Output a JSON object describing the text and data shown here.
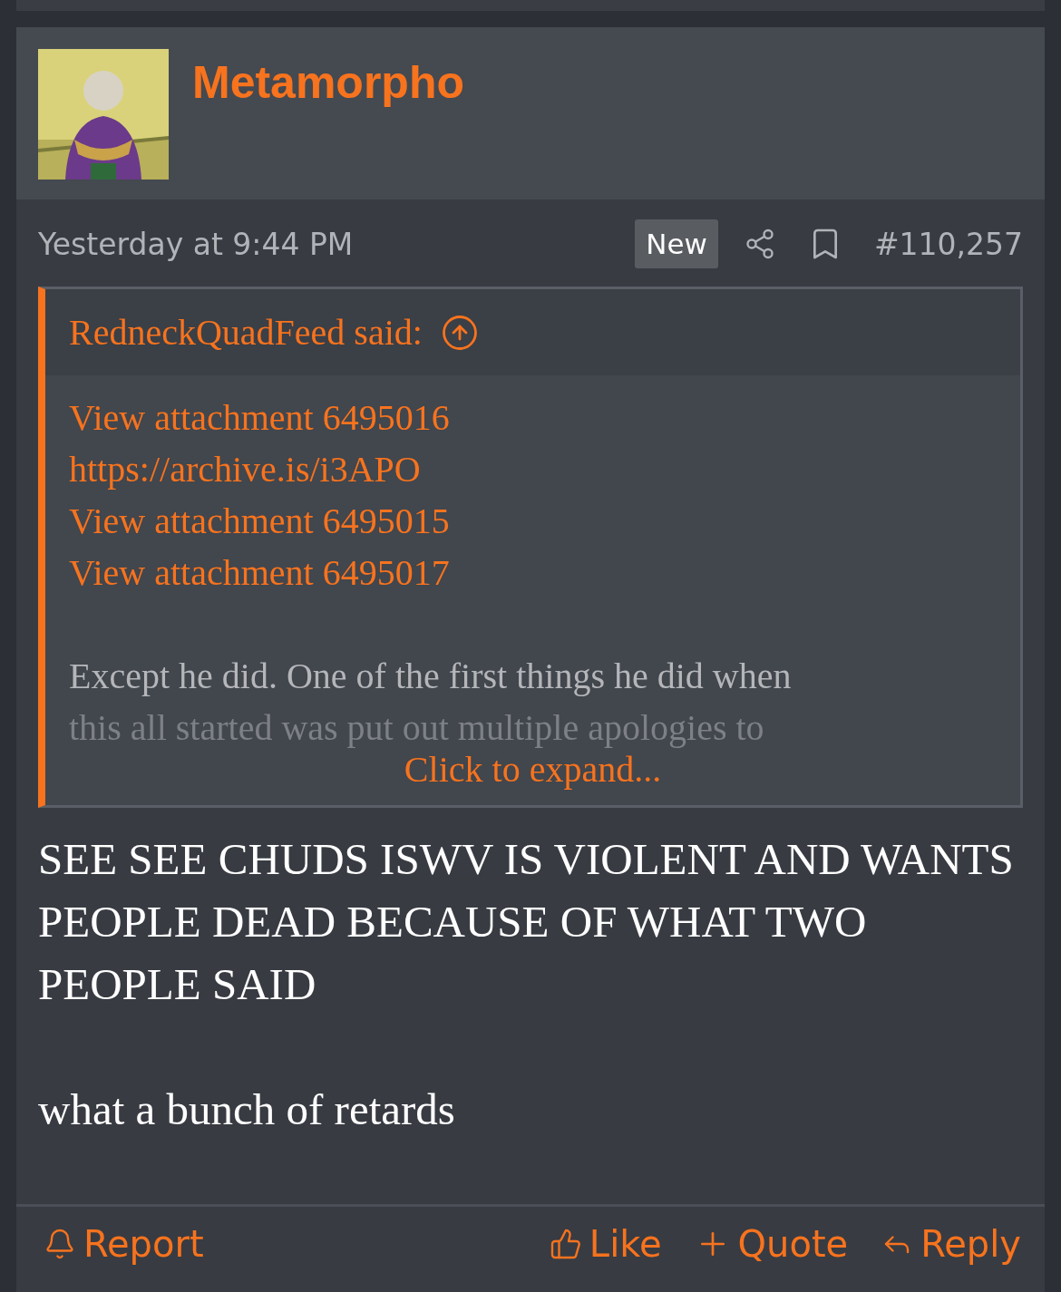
{
  "post": {
    "author": "Metamorpho",
    "time": "Yesterday at 9:44 PM",
    "badge": "New",
    "number": "#110,257",
    "quote": {
      "author": "RedneckQuadFeed said:",
      "links": [
        "View attachment 6495016",
        "https://archive.is/i3APO",
        "View attachment 6495015",
        "View attachment 6495017"
      ],
      "lines": [
        "Except he did. One of the first things he did when",
        "this all started was put out multiple apologies to"
      ],
      "expand": "Click to expand..."
    },
    "body": [
      "SEE SEE CHUDS ISWV IS VIOLENT AND WANTS PEOPLE DEAD BECAUSE OF WHAT TWO PEOPLE SAID",
      "what a bunch of retards"
    ],
    "actions": [
      {
        "kind": "report",
        "label": "Report"
      },
      {
        "kind": "like",
        "label": "Like"
      },
      {
        "kind": "quote",
        "label": "Quote"
      },
      {
        "kind": "reply",
        "label": "Reply"
      }
    ]
  }
}
